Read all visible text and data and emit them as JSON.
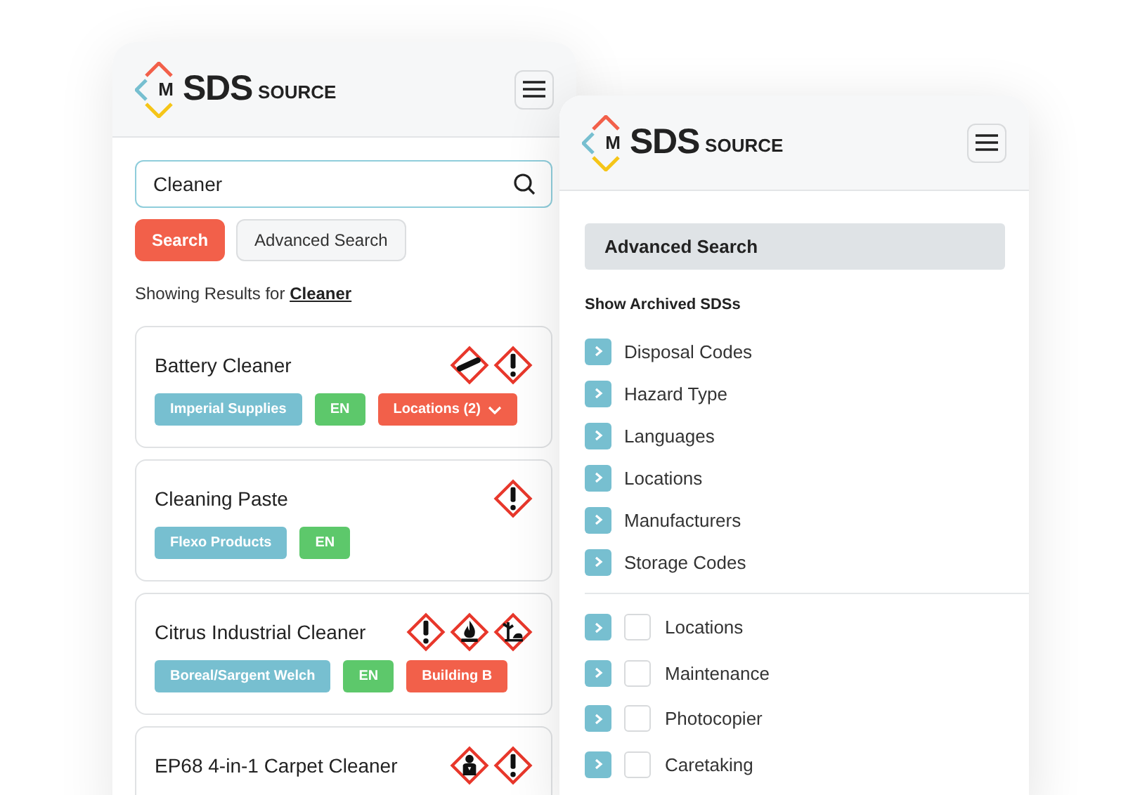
{
  "results_panel": {
    "logo": {
      "mark": "M",
      "name": "SDS",
      "suffix": "SOURCE"
    },
    "search": {
      "value": "Cleaner"
    },
    "buttons": [
      {
        "label": "Search",
        "kind": "primary"
      },
      {
        "label": "Advanced Search",
        "kind": "secondary"
      }
    ],
    "summary": {
      "prefix": "Showing Results for",
      "query": "Cleaner"
    },
    "results": [
      {
        "title": "Battery Cleaner",
        "hazards": [
          {
            "kind": "gas"
          },
          {
            "kind": "exclamation"
          }
        ],
        "tags": [
          {
            "label": "Imperial Supplies",
            "color": "#77bfd0",
            "dropdown": false
          },
          {
            "label": "EN",
            "color": "#5dc86b",
            "dropdown": false
          },
          {
            "label": "Locations (2)",
            "color": "#f2604a",
            "dropdown": true
          }
        ]
      },
      {
        "title": "Cleaning Paste",
        "hazards": [
          {
            "kind": "exclamation"
          }
        ],
        "tags": [
          {
            "label": "Flexo Products",
            "color": "#77bfd0",
            "dropdown": false
          },
          {
            "label": "EN",
            "color": "#5dc86b",
            "dropdown": false
          }
        ]
      },
      {
        "title": "Citrus Industrial Cleaner",
        "hazards": [
          {
            "kind": "exclamation"
          },
          {
            "kind": "flame"
          },
          {
            "kind": "environment"
          }
        ],
        "tags": [
          {
            "label": "Boreal/Sargent Welch",
            "color": "#77bfd0",
            "dropdown": false
          },
          {
            "label": "EN",
            "color": "#5dc86b",
            "dropdown": false
          },
          {
            "label": "Building B",
            "color": "#f2604a",
            "dropdown": false
          }
        ]
      },
      {
        "title": "EP68 4-in-1 Carpet Cleaner",
        "hazards": [
          {
            "kind": "health"
          },
          {
            "kind": "exclamation"
          }
        ]
      }
    ]
  },
  "advanced_panel": {
    "logo": {
      "mark": "M",
      "name": "SDS",
      "suffix": "SOURCE"
    },
    "heading": "Advanced Search",
    "archived_label": "Show Archived SDSs",
    "filters": [
      {
        "label": "Disposal Codes",
        "kind": "expander"
      },
      {
        "label": "Hazard Type",
        "kind": "expander"
      },
      {
        "label": "Languages",
        "kind": "expander"
      },
      {
        "label": "Locations",
        "kind": "expander"
      },
      {
        "label": "Manufacturers",
        "kind": "expander"
      },
      {
        "label": "Storage Codes",
        "kind": "expander"
      }
    ],
    "categories": [
      {
        "label": "Locations",
        "checked": false
      },
      {
        "label": "Maintenance",
        "checked": false
      },
      {
        "label": "Photocopier",
        "checked": false
      },
      {
        "label": "Caretaking",
        "checked": false
      }
    ]
  }
}
